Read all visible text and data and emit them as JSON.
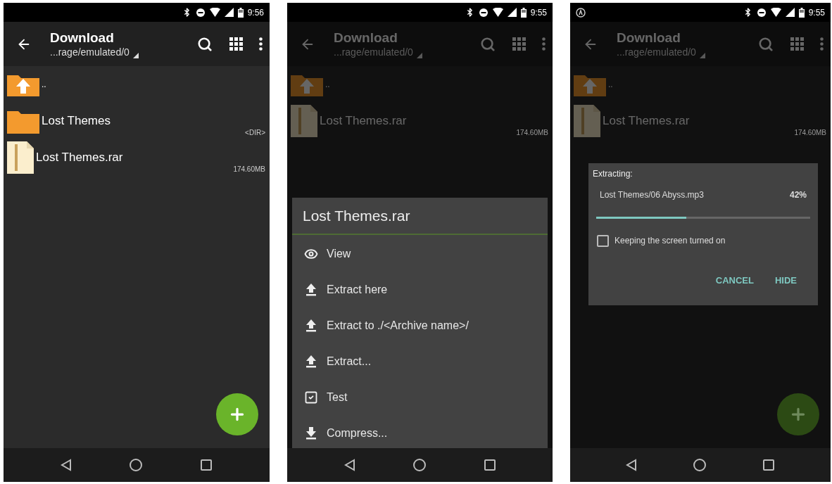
{
  "phones": [
    {
      "status_bar": {
        "time": "9:56"
      },
      "app_bar": {
        "title": "Download",
        "path": "...rage/emulated/0"
      },
      "files": [
        {
          "kind": "up",
          "name": ".."
        },
        {
          "kind": "folder",
          "name": "Lost Themes",
          "info": "<DIR>"
        },
        {
          "kind": "archive",
          "name": "Lost Themes.rar",
          "info": "174.60MB"
        }
      ]
    },
    {
      "status_bar": {
        "time": "9:55"
      },
      "app_bar": {
        "title": "Download",
        "path": "...rage/emulated/0"
      },
      "dimmed": true,
      "files": [
        {
          "kind": "up",
          "name": ".."
        },
        {
          "kind": "archive",
          "name": "Lost Themes.rar",
          "info": "174.60MB"
        }
      ],
      "dialog": {
        "kind": "menu",
        "title": "Lost Themes.rar",
        "items": [
          {
            "kind": "view",
            "label": "View"
          },
          {
            "kind": "extract",
            "label": "Extract here"
          },
          {
            "kind": "extract",
            "label": "Extract to ./<Archive name>/"
          },
          {
            "kind": "extract",
            "label": "Extract..."
          },
          {
            "kind": "test",
            "label": "Test"
          },
          {
            "kind": "compress",
            "label": "Compress..."
          }
        ]
      }
    },
    {
      "status_bar": {
        "notification": true,
        "time": "9:55"
      },
      "app_bar": {
        "title": "Download",
        "path": "...rage/emulated/0"
      },
      "dimmed": true,
      "files": [
        {
          "kind": "up",
          "name": ".."
        },
        {
          "kind": "archive",
          "name": "Lost Themes.rar",
          "info": "174.60MB"
        }
      ],
      "dialog": {
        "kind": "progress",
        "heading": "Extracting:",
        "file": "Lost Themes/06 Abyss.mp3",
        "percent": "42%",
        "level": 0.42,
        "checkbox": {
          "label": "Keeping the screen turned on",
          "checked": false
        },
        "buttons": [
          "CANCEL",
          "HIDE"
        ]
      }
    }
  ]
}
